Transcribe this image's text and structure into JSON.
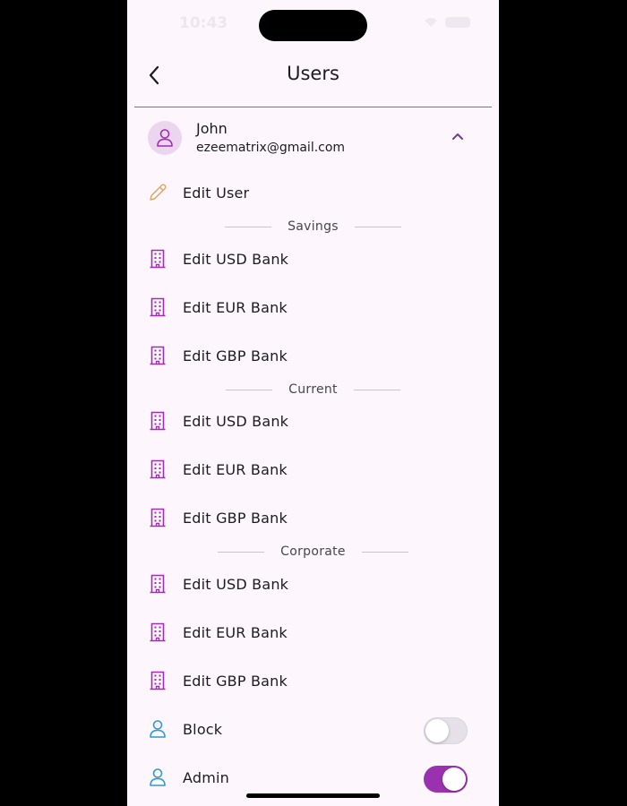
{
  "status_bar": {
    "time": "10:43"
  },
  "appbar": {
    "title": "Users",
    "back_icon": "chevron-left-icon"
  },
  "user": {
    "name": "John",
    "email": "ezeematrix@gmail.com",
    "avatar_icon": "person-icon",
    "expand_icon": "chevron-up-icon",
    "expanded": true
  },
  "edit_user": {
    "label": "Edit User",
    "icon": "pencil-icon"
  },
  "sections": [
    {
      "title": "Savings",
      "items": [
        {
          "label": "Edit USD Bank"
        },
        {
          "label": "Edit EUR Bank"
        },
        {
          "label": "Edit GBP Bank"
        }
      ]
    },
    {
      "title": "Current",
      "items": [
        {
          "label": "Edit USD Bank"
        },
        {
          "label": "Edit EUR Bank"
        },
        {
          "label": "Edit GBP Bank"
        }
      ]
    },
    {
      "title": "Corporate",
      "items": [
        {
          "label": "Edit USD Bank"
        },
        {
          "label": "Edit EUR Bank"
        },
        {
          "label": "Edit GBP Bank"
        }
      ]
    }
  ],
  "toggles": [
    {
      "label": "Block",
      "icon": "person-outline-icon",
      "on": false
    },
    {
      "label": "Admin",
      "icon": "person-outline-icon",
      "on": true
    }
  ],
  "colors": {
    "accent": "#9a32b0",
    "bank_icon": "#a12db4",
    "pencil_icon": "#dba66a",
    "person_icon": "#2b9bd6",
    "background": "#fdf7fd"
  }
}
